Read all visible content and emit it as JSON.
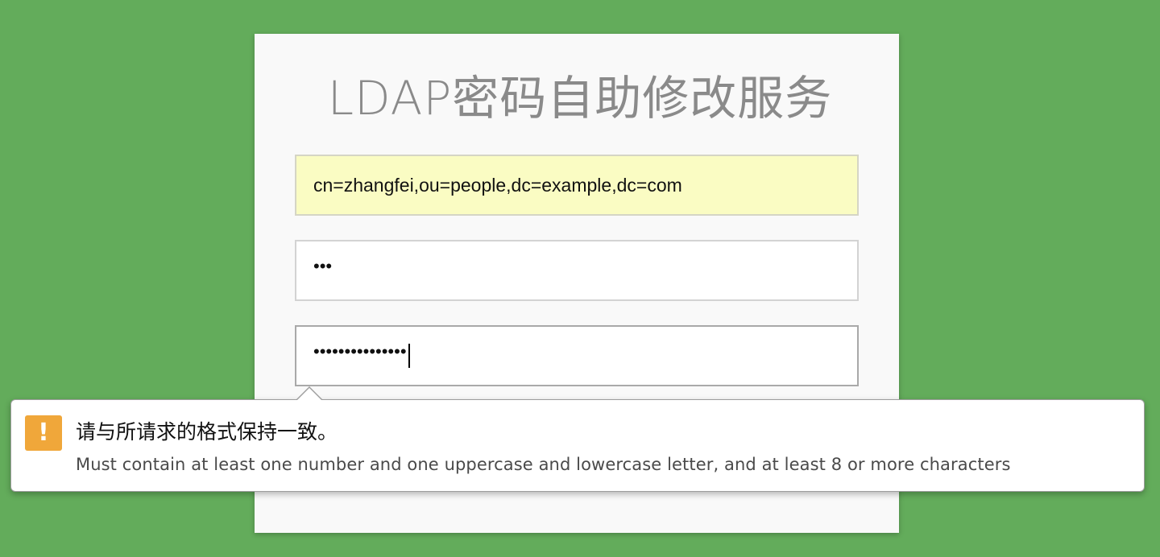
{
  "page": {
    "title": "LDAP密码自助修改服务"
  },
  "form": {
    "username_value": "cn=zhangfei,ou=people,dc=example,dc=com",
    "old_password_mask": "•••",
    "new_password_mask": "•••••••••••••••"
  },
  "validation_tooltip": {
    "message": "请与所请求的格式保持一致。",
    "detail": "Must contain at least one number and one uppercase and lowercase letter, and at least 8 or more characters",
    "icon": "exclamation-icon",
    "icon_glyph": "!",
    "icon_color": "#f0a73a"
  },
  "colors": {
    "background": "#63ac5b",
    "card": "#f9f9f9",
    "autofill": "#fafcc3"
  }
}
